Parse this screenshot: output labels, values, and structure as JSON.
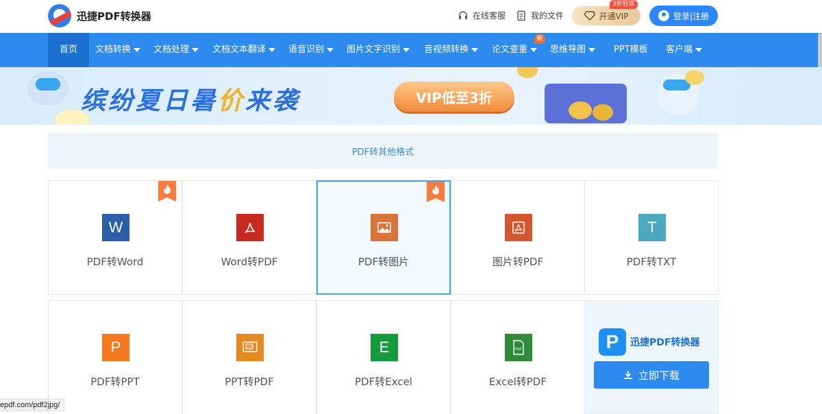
{
  "header": {
    "logo_text": "迅捷PDF转换器",
    "support_label": "在线客服",
    "my_files_label": "我的文件",
    "vip_label": "开通VIP",
    "vip_tag": "3折狂欢",
    "login_label": "登录|注册"
  },
  "nav": {
    "items": [
      {
        "label": "首页",
        "dropdown": false
      },
      {
        "label": "文档转换",
        "dropdown": true
      },
      {
        "label": "文档处理",
        "dropdown": true
      },
      {
        "label": "文档文本翻译",
        "dropdown": true
      },
      {
        "label": "语音识别",
        "dropdown": true
      },
      {
        "label": "图片文字识别",
        "dropdown": true
      },
      {
        "label": "音视频转换",
        "dropdown": true
      },
      {
        "label": "论文查重",
        "dropdown": true
      },
      {
        "label": "思维导图",
        "dropdown": true
      },
      {
        "label": "PPT模板",
        "dropdown": false
      },
      {
        "label": "客户端",
        "dropdown": true
      }
    ],
    "new_badge": "新"
  },
  "banner": {
    "title_part1": "缤纷夏日暑",
    "title_highlight": "价",
    "title_part2": "来袭",
    "pill_text": "VIP低至3折"
  },
  "section": {
    "title": "PDF转其他格式"
  },
  "tools": [
    {
      "label": "PDF转Word",
      "icon_char": "W",
      "color": "#2a5ea8",
      "hot": true
    },
    {
      "label": "Word转PDF",
      "icon_char": "",
      "color": "#c8281e",
      "hot": false
    },
    {
      "label": "PDF转图片",
      "icon_char": "",
      "color": "#d8733a",
      "hot": true
    },
    {
      "label": "图片转PDF",
      "icon_char": "",
      "color": "#d4562e",
      "hot": false
    },
    {
      "label": "PDF转TXT",
      "icon_char": "T",
      "color": "#4aa8bf",
      "hot": false
    },
    {
      "label": "PDF转PPT",
      "icon_char": "P",
      "color": "#f5791f",
      "hot": false
    },
    {
      "label": "PPT转PDF",
      "icon_char": "",
      "color": "#e58a1e",
      "hot": false
    },
    {
      "label": "PDF转Excel",
      "icon_char": "E",
      "color": "#149b3c",
      "hot": false
    },
    {
      "label": "Excel转PDF",
      "icon_char": "",
      "color": "#2f8a3c",
      "hot": false
    }
  ],
  "download": {
    "logo_text": "迅捷PDF转换器",
    "logo_mark": "P",
    "button_label": "立即下载"
  },
  "status_bar": {
    "url": "epdf.com/pdf2jpg/"
  }
}
